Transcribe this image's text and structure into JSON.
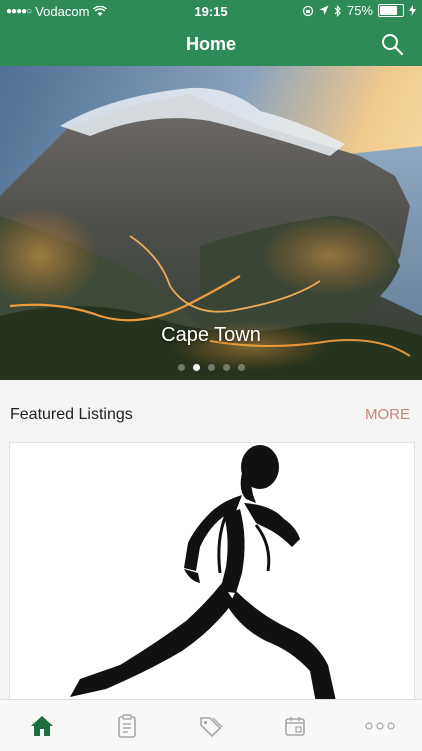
{
  "status_bar": {
    "signal_dots": "●●●●○",
    "carrier": "Vodacom",
    "time": "19:15",
    "battery": "75%",
    "battery_level": 0.75
  },
  "nav": {
    "title": "Home",
    "search_icon": "search-icon"
  },
  "hero": {
    "caption": "Cape Town",
    "pages": 5,
    "active_page": 2
  },
  "featured": {
    "title": "Featured Listings",
    "more_label": "MORE"
  },
  "tabs": [
    {
      "name": "home-icon",
      "active": true
    },
    {
      "name": "clipboard-icon",
      "active": false
    },
    {
      "name": "tags-icon",
      "active": false
    },
    {
      "name": "calendar-icon",
      "active": false
    },
    {
      "name": "more-dots-icon",
      "active": false
    }
  ],
  "colors": {
    "brand_green": "#2e8b57",
    "more_accent": "#c98673",
    "tab_active": "#1f6e42",
    "tab_inactive": "#a8a8a8"
  }
}
